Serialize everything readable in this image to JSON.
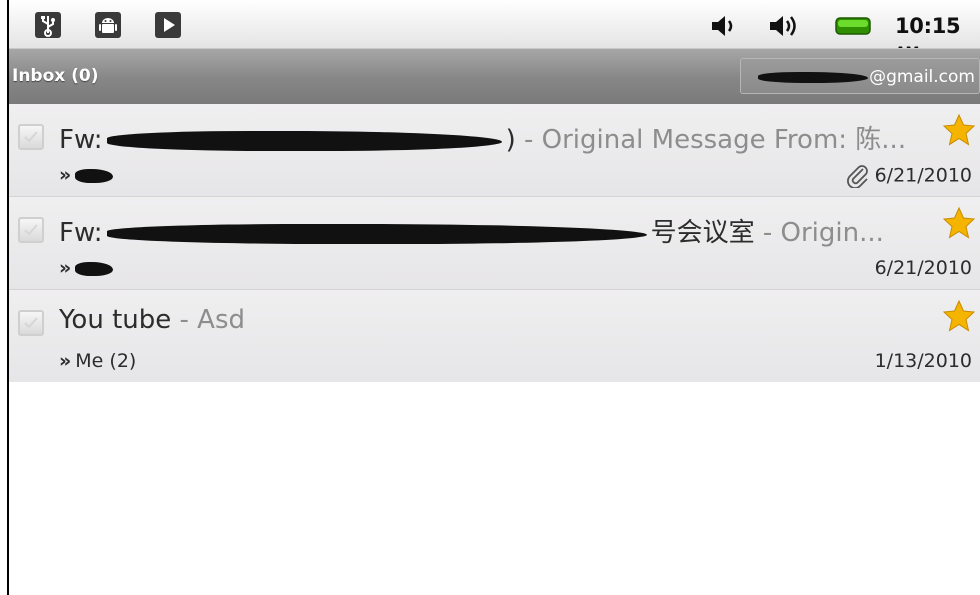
{
  "status_bar": {
    "time": "10:15",
    "ampm": "AM",
    "icons": [
      "usb-icon",
      "android-icon",
      "play-icon",
      "volume-icon",
      "volume-loud-icon",
      "battery-icon"
    ],
    "battery_color": "#37b200"
  },
  "header": {
    "title": "Inbox (0)",
    "account_suffix": "@gmail.com"
  },
  "colors": {
    "star": "#f4b400",
    "snippet": "#8d8d8d",
    "titlebar": "#868686"
  },
  "messages": [
    {
      "subject_prefix": "Fw:",
      "subject_tail": ")",
      "snippet": " - Original Message   From: 陈...",
      "participants_prefix": "»",
      "date": "6/21/2010",
      "has_attachment": true,
      "starred": true
    },
    {
      "subject_prefix": "Fw:",
      "subject_tail": "号会议室",
      "snippet": " - Origin...",
      "participants_prefix": "»",
      "date": "6/21/2010",
      "has_attachment": false,
      "starred": true
    },
    {
      "subject": "You tube",
      "snippet": " - Asd",
      "participants_prefix": "»",
      "participants": "Me (2)",
      "date": "1/13/2010",
      "has_attachment": false,
      "starred": true
    }
  ]
}
